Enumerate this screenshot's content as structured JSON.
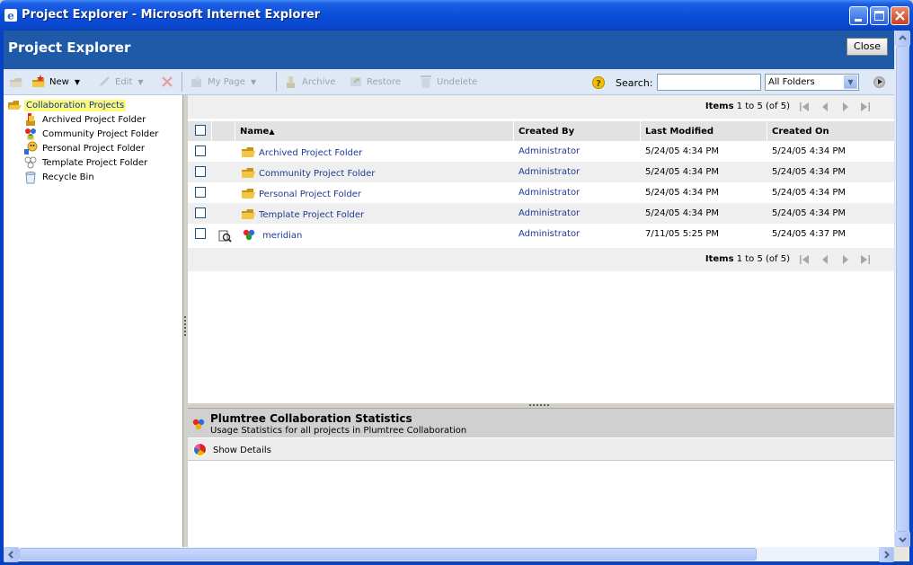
{
  "window": {
    "title": "Project Explorer - Microsoft Internet Explorer",
    "colors": {
      "titlebar": "#0a4ed8",
      "header": "#1e5aa8"
    }
  },
  "header": {
    "title": "Project Explorer",
    "close_label": "Close"
  },
  "toolbar": {
    "new_label": "New",
    "edit_label": "Edit",
    "my_page_label": "My Page",
    "archive_label": "Archive",
    "restore_label": "Restore",
    "undelete_label": "Undelete",
    "search_label": "Search:",
    "search_value": "",
    "folder_filter": "All Folders"
  },
  "tree": {
    "root": "Collaboration Projects",
    "items": [
      {
        "label": "Archived Project Folder",
        "icon": "archived-folder-icon"
      },
      {
        "label": "Community Project Folder",
        "icon": "community-folder-icon"
      },
      {
        "label": "Personal Project Folder",
        "icon": "personal-folder-icon"
      },
      {
        "label": "Template Project Folder",
        "icon": "template-folder-icon"
      },
      {
        "label": "Recycle Bin",
        "icon": "recycle-bin-icon"
      }
    ]
  },
  "grid": {
    "pager_prefix": "Items",
    "pager_range": "1 to 5 (of 5)",
    "columns": {
      "name": "Name",
      "created_by": "Created By",
      "last_modified": "Last Modified",
      "created_on": "Created On"
    },
    "sort_indicator": "▲",
    "rows": [
      {
        "name": "Archived Project Folder",
        "created_by": "Administrator",
        "last_modified": "5/24/05 4:34 PM",
        "created_on": "5/24/05 4:34 PM",
        "type": "folder"
      },
      {
        "name": "Community Project Folder",
        "created_by": "Administrator",
        "last_modified": "5/24/05 4:34 PM",
        "created_on": "5/24/05 4:34 PM",
        "type": "folder"
      },
      {
        "name": "Personal Project Folder",
        "created_by": "Administrator",
        "last_modified": "5/24/05 4:34 PM",
        "created_on": "5/24/05 4:34 PM",
        "type": "folder"
      },
      {
        "name": "Template Project Folder",
        "created_by": "Administrator",
        "last_modified": "5/24/05 4:34 PM",
        "created_on": "5/24/05 4:34 PM",
        "type": "folder"
      },
      {
        "name": "meridian",
        "created_by": "Administrator",
        "last_modified": "7/11/05 5:25 PM",
        "created_on": "5/24/05 4:37 PM",
        "type": "project"
      }
    ]
  },
  "stats": {
    "title": "Plumtree Collaboration Statistics",
    "subtitle": "Usage Statistics for all projects in Plumtree Collaboration",
    "show_details": "Show Details"
  }
}
